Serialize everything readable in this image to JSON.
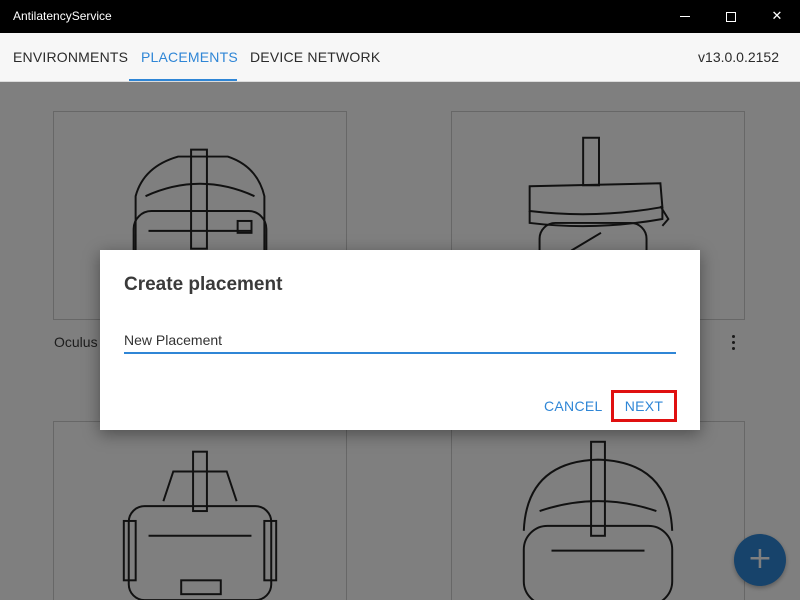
{
  "window": {
    "title": "AntilatencyService",
    "minimize_icon": "minimize-icon",
    "maximize_icon": "maximize-icon",
    "close_icon": "close-icon",
    "close_glyph": "✕"
  },
  "tabs": [
    {
      "label": "ENVIRONMENTS",
      "active": false
    },
    {
      "label": "PLACEMENTS",
      "active": true
    },
    {
      "label": "DEVICE NETWORK",
      "active": false
    }
  ],
  "version": "v13.0.0.2152",
  "cards": [
    {
      "label": "Oculus",
      "icon": "vr-headset-icon"
    },
    {
      "label": "",
      "icon": "vr-headset-icon"
    },
    {
      "label": "",
      "icon": "vr-headset-icon"
    },
    {
      "label": "",
      "icon": "vr-headset-icon"
    }
  ],
  "fab": {
    "glyph": "+",
    "icon": "add-icon"
  },
  "dialog": {
    "title": "Create placement",
    "input_value": "New Placement",
    "cancel_label": "CANCEL",
    "next_label": "NEXT"
  },
  "colors": {
    "accent": "#2f86d6",
    "highlight": "#e01010",
    "titlebar": "#000000"
  }
}
